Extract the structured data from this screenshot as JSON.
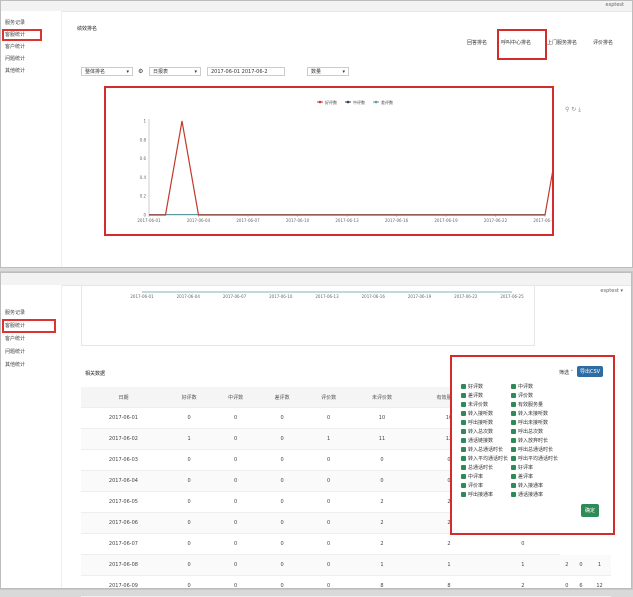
{
  "user": "esptest",
  "sidebar": [
    "服务记录",
    "客服统计",
    "客户统计",
    "问题统计",
    "其他统计"
  ],
  "panel1": {
    "title": "绩效排名",
    "tabs": [
      "回答排名",
      "呼叫中心排名",
      "上门服务排名",
      "评价排名"
    ],
    "filters": {
      "scope": "整体排名",
      "period": "日报表",
      "date_range": "2017-06-01 2017-06-2",
      "metric": "数量"
    },
    "chart_icons": "⚲ ↻ ⤓"
  },
  "chart_data": {
    "type": "line",
    "x": [
      "2017-06-01",
      "2017-06-04",
      "2017-06-07",
      "2017-06-10",
      "2017-06-13",
      "2017-06-16",
      "2017-06-19",
      "2017-06-22",
      "2017-06-25"
    ],
    "y_ticks": [
      "1",
      "0.8",
      "0.6",
      "0.4",
      "0.2",
      "0"
    ],
    "ylim": [
      0,
      1
    ],
    "series": [
      {
        "name": "好评数",
        "color": "#c0392b",
        "points": [
          [
            0,
            0
          ],
          [
            1,
            0
          ],
          [
            2,
            1
          ],
          [
            3,
            0
          ],
          [
            24,
            0
          ],
          [
            25,
            1
          ],
          [
            26,
            0
          ]
        ]
      },
      {
        "name": "中评数",
        "color": "#2c3e50",
        "points": []
      },
      {
        "name": "差评数",
        "color": "#5b9aa0",
        "points": [
          [
            26,
            0
          ],
          [
            27,
            1
          ],
          [
            28,
            0
          ]
        ]
      }
    ]
  },
  "panel2": {
    "section_title": "相关数据",
    "filter_label": "筛选 ˅",
    "export_label": "导出CSV",
    "confirm_label": "确定",
    "columns": [
      "日期",
      "好评数",
      "中评数",
      "差评数",
      "评价数",
      "未评价数",
      "有效服务量",
      "转入接听数"
    ],
    "rows": [
      [
        "2017-06-01",
        "0",
        "0",
        "0",
        "0",
        "10",
        "10",
        "0"
      ],
      [
        "2017-06-02",
        "1",
        "0",
        "0",
        "1",
        "11",
        "12",
        "0"
      ],
      [
        "2017-06-03",
        "0",
        "0",
        "0",
        "0",
        "0",
        "0",
        "0"
      ],
      [
        "2017-06-04",
        "0",
        "0",
        "0",
        "0",
        "0",
        "0",
        "0"
      ],
      [
        "2017-06-05",
        "0",
        "0",
        "0",
        "0",
        "2",
        "2",
        "0"
      ],
      [
        "2017-06-06",
        "0",
        "0",
        "0",
        "0",
        "2",
        "2",
        "0"
      ],
      [
        "2017-06-07",
        "0",
        "0",
        "0",
        "0",
        "2",
        "2",
        "0"
      ],
      [
        "2017-06-08",
        "0",
        "0",
        "0",
        "0",
        "1",
        "1",
        "1",
        "2",
        "0",
        "1"
      ],
      [
        "2017-06-09",
        "0",
        "0",
        "0",
        "0",
        "8",
        "8",
        "2",
        "0",
        "6",
        "12"
      ]
    ],
    "checkboxes": [
      [
        "好评数",
        "中评数"
      ],
      [
        "差评数",
        "评价数"
      ],
      [
        "未评价数",
        "有效服务量"
      ],
      [
        "转入接听数",
        "转入未接听数"
      ],
      [
        "呼出接听数",
        "呼出未接听数"
      ],
      [
        "转入总次数",
        "呼出总次数"
      ],
      [
        "通话链接数",
        "转入放弃时长"
      ],
      [
        "转入总通话时长",
        "呼出总通话时长"
      ],
      [
        "转入平均通话时长",
        "呼出平均通话时长"
      ],
      [
        "总通话时长",
        "好评率"
      ],
      [
        "中评率",
        "差评率"
      ],
      [
        "评价率",
        "转入接通率"
      ],
      [
        "呼出接通率",
        "通话接通率"
      ]
    ]
  }
}
